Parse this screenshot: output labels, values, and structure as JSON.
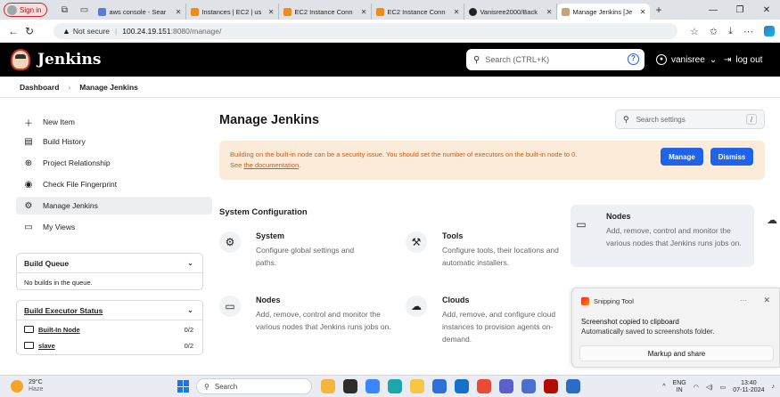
{
  "browser": {
    "profile_label": "Sign in",
    "tabs": [
      {
        "title": "aws console - Sear",
        "color": "#5a7bd6"
      },
      {
        "title": "Instances | EC2 | us",
        "color": "#f08a1c"
      },
      {
        "title": "EC2 Instance Conn",
        "color": "#f08a1c"
      },
      {
        "title": "EC2 Instance Conn",
        "color": "#f08a1c"
      },
      {
        "title": "Vanisree2000/Back",
        "color": "#222222"
      },
      {
        "title": "Manage Jenkins [Je",
        "color": "#c8a27a"
      }
    ],
    "not_secure": "Not secure",
    "url_host": "100.24.19.151",
    "url_rest": ":8080/manage/"
  },
  "jenkins": {
    "title": "Jenkins",
    "search_placeholder": "Search (CTRL+K)",
    "help_glyph": "?",
    "username": "vanisree",
    "logout": "log out"
  },
  "breadcrumb": [
    "Dashboard",
    "Manage Jenkins"
  ],
  "sidebar": {
    "items": [
      {
        "label": "New Item",
        "icon": "plus-icon"
      },
      {
        "label": "Build History",
        "icon": "history-icon"
      },
      {
        "label": "Project Relationship",
        "icon": "relationship-icon"
      },
      {
        "label": "Check File Fingerprint",
        "icon": "fingerprint-icon"
      },
      {
        "label": "Manage Jenkins",
        "icon": "gear-icon"
      },
      {
        "label": "My Views",
        "icon": "window-icon"
      }
    ],
    "build_queue": {
      "title": "Build Queue",
      "empty": "No builds in the queue."
    },
    "executor_status": {
      "title": "Build Executor Status",
      "rows": [
        {
          "name": "Built-In Node",
          "count": "0/2"
        },
        {
          "name": "slave",
          "count": "0/2"
        }
      ]
    }
  },
  "main": {
    "title": "Manage Jenkins",
    "search_settings_placeholder": "Search settings",
    "search_shortcut": "/",
    "warning_text": "Building on the built-in node can be a security issue. You should set the number of executors on the built-in node to 0.",
    "warning_see": "See ",
    "warning_link": "the documentation",
    "warning_end": ".",
    "manage_btn": "Manage",
    "dismiss_btn": "Dismiss",
    "section": "System Configuration",
    "cards": [
      {
        "title": "System",
        "desc": "Configure global settings and paths.",
        "icon": "gear-icon"
      },
      {
        "title": "Tools",
        "desc": "Configure tools, their locations and automatic installers.",
        "icon": "hammer-icon"
      },
      {
        "title": "Nodes",
        "desc": "Add, remove, control and monitor the various nodes that Jenkins runs jobs on.",
        "icon": "monitor-icon"
      },
      {
        "title": "Clouds",
        "desc": "Add, remove, and configure cloud instances to provision agents on-demand.",
        "icon": "cloud-icon"
      },
      {
        "title": "Nodes",
        "desc": "Add, remove, control and monitor the various nodes that Jenkins runs jobs on.",
        "icon": "monitor-icon"
      }
    ]
  },
  "toast": {
    "app": "Snipping Tool",
    "line1": "Screenshot copied to clipboard",
    "line2": "Automatically saved to screenshots folder.",
    "button": "Markup and share"
  },
  "taskbar": {
    "temp": "29°C",
    "weather": "Haze",
    "search": "Search",
    "lang1": "ENG",
    "lang2": "IN",
    "time": "13:40",
    "date": "07-11-2024"
  }
}
